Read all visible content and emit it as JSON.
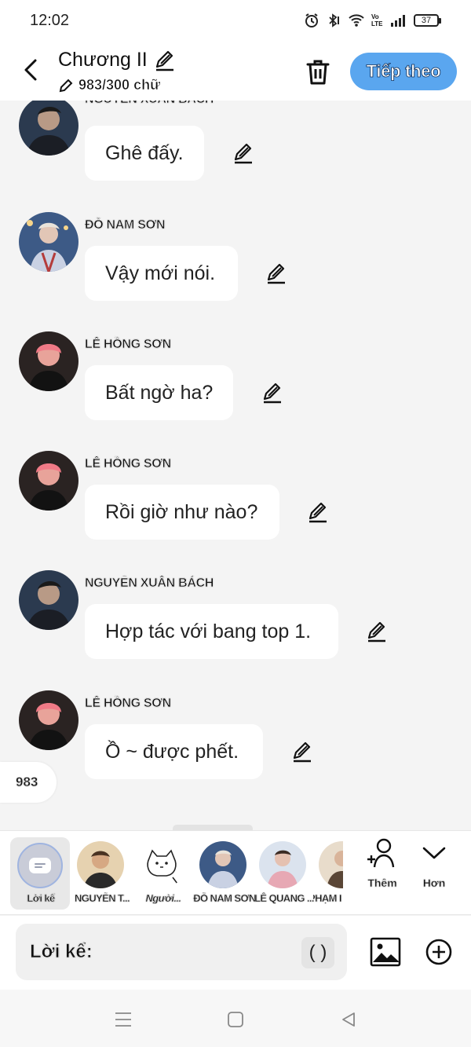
{
  "status_bar": {
    "time": "12:02",
    "battery": "37",
    "network": "Vo LTE"
  },
  "header": {
    "title": "Chương II",
    "word_count": "983/300 chữ",
    "next_label": "Tiếp theo"
  },
  "messages": [
    {
      "speaker": "NGUYỄN XUÂN BÁCH",
      "text": "Ghê đấy.",
      "avatar": "bach"
    },
    {
      "speaker": "ĐỖ NAM SƠN",
      "text": "Vậy mới nói.",
      "avatar": "son-nam"
    },
    {
      "speaker": "LÊ HỒNG SƠN",
      "text": "Bất ngờ ha?",
      "avatar": "hong-son"
    },
    {
      "speaker": "LÊ HỒNG SƠN",
      "text": "Rồi giờ như nào?",
      "avatar": "hong-son"
    },
    {
      "speaker": "NGUYỄN XUÂN BÁCH",
      "text": "Hợp tác với bang top 1.",
      "avatar": "bach"
    },
    {
      "speaker": "LÊ HỒNG SƠN",
      "text": "Ồ ~ được phết.",
      "avatar": "hong-son"
    }
  ],
  "side_counter": "983",
  "characters": [
    {
      "label": "Lời kể",
      "icon": "narration-icon",
      "selected": true
    },
    {
      "label": "NGUYỄN T...",
      "avatar": "nguyen-t"
    },
    {
      "label": "Người...",
      "avatar": "cat-sketch"
    },
    {
      "label": "ĐỖ NAM SƠN",
      "avatar": "son-nam"
    },
    {
      "label": "LÊ QUANG ...",
      "avatar": "le-quang"
    },
    {
      "label": "PHẠM I",
      "avatar": "pham"
    }
  ],
  "strip_actions": {
    "more_label": "Thêm",
    "expand_label": "Hơn"
  },
  "input": {
    "placeholder": "Lời kể:",
    "paren_label": "( )"
  },
  "colors": {
    "accent": "#5aa6ef",
    "bubble": "#ffffff",
    "background": "#f4f4f4"
  }
}
